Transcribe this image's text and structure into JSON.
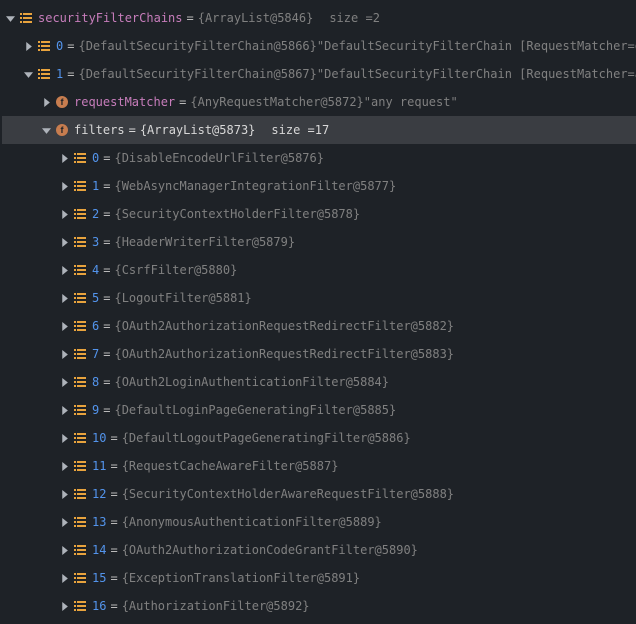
{
  "root": {
    "name": "securityFilterChains",
    "value": "{ArrayList@5846}",
    "sizeLabel": "size =",
    "sizeValue": "2"
  },
  "chains": [
    {
      "idx": "0",
      "value": "{DefaultSecurityFilterChain@5866}",
      "text": "\"DefaultSecurityFilterChain [RequestMatcher=o…"
    },
    {
      "idx": "1",
      "value": "{DefaultSecurityFilterChain@5867}",
      "text": "\"DefaultSecurityFilterChain [RequestMatcher=a…"
    }
  ],
  "requestMatcher": {
    "name": "requestMatcher",
    "value": "{AnyRequestMatcher@5872}",
    "text": "\"any request\""
  },
  "filtersNode": {
    "name": "filters",
    "value": "{ArrayList@5873}",
    "sizeLabel": "size =",
    "sizeValue": "17"
  },
  "filters": [
    {
      "idx": "0",
      "value": "{DisableEncodeUrlFilter@5876}"
    },
    {
      "idx": "1",
      "value": "{WebAsyncManagerIntegrationFilter@5877}"
    },
    {
      "idx": "2",
      "value": "{SecurityContextHolderFilter@5878}"
    },
    {
      "idx": "3",
      "value": "{HeaderWriterFilter@5879}"
    },
    {
      "idx": "4",
      "value": "{CsrfFilter@5880}"
    },
    {
      "idx": "5",
      "value": "{LogoutFilter@5881}"
    },
    {
      "idx": "6",
      "value": "{OAuth2AuthorizationRequestRedirectFilter@5882}"
    },
    {
      "idx": "7",
      "value": "{OAuth2AuthorizationRequestRedirectFilter@5883}"
    },
    {
      "idx": "8",
      "value": "{OAuth2LoginAuthenticationFilter@5884}"
    },
    {
      "idx": "9",
      "value": "{DefaultLoginPageGeneratingFilter@5885}"
    },
    {
      "idx": "10",
      "value": "{DefaultLogoutPageGeneratingFilter@5886}"
    },
    {
      "idx": "11",
      "value": "{RequestCacheAwareFilter@5887}"
    },
    {
      "idx": "12",
      "value": "{SecurityContextHolderAwareRequestFilter@5888}"
    },
    {
      "idx": "13",
      "value": "{AnonymousAuthenticationFilter@5889}"
    },
    {
      "idx": "14",
      "value": "{OAuth2AuthorizationCodeGrantFilter@5890}"
    },
    {
      "idx": "15",
      "value": "{ExceptionTranslationFilter@5891}"
    },
    {
      "idx": "16",
      "value": "{AuthorizationFilter@5892}"
    }
  ]
}
